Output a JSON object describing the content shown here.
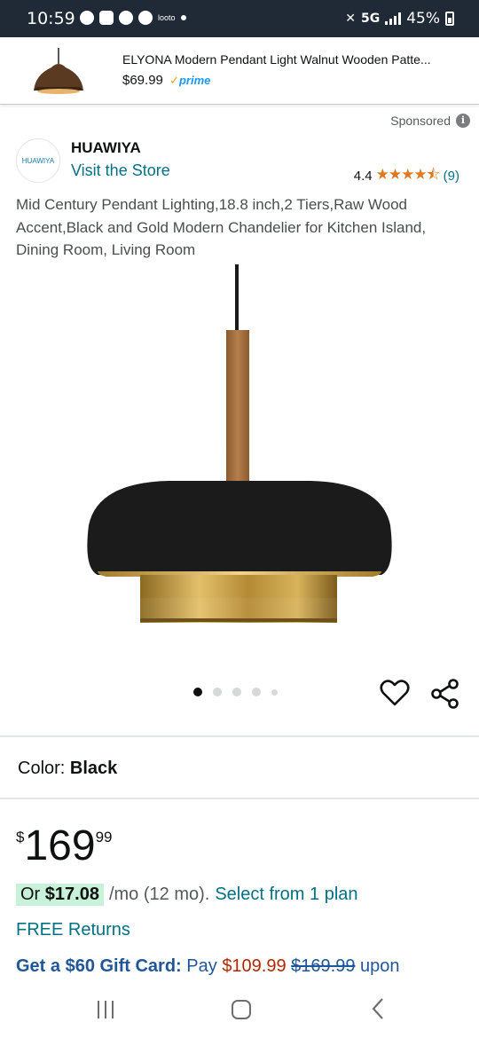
{
  "status_bar": {
    "time": "10:59",
    "tag": "looto",
    "network": "5G",
    "battery": "45%"
  },
  "sticky": {
    "title": "ELYONA Modern Pendant Light Walnut Wooden Patte...",
    "price": "$69.99",
    "prime_label": "prime"
  },
  "sponsored_label": "Sponsored",
  "brand": {
    "logo_text": "HUAWIYA",
    "name": "HUAWIYA",
    "visit_store": "Visit the Store"
  },
  "rating": {
    "value": "4.4",
    "count": "(9)",
    "stars": "★★★★⯪"
  },
  "product": {
    "title": "Mid Century Pendant Lighting,18.8 inch,2 Tiers,Raw Wood Accent,Black and Gold Modern Chandelier for Kitchen Island, Dining Room, Living Room"
  },
  "color": {
    "label": "Color:",
    "value": "Black"
  },
  "price": {
    "symbol": "$",
    "whole": "169",
    "fraction": "99"
  },
  "installment": {
    "or_label": "Or",
    "amount": "$17.08",
    "term": "/mo (12 mo).",
    "link": "Select from 1 plan"
  },
  "free_returns": "FREE Returns",
  "gift_card": {
    "headline": "Get a $60 Gift Card:",
    "pay": "Pay",
    "new_price": "$109.99",
    "old_price": "$169.99",
    "tail": "upon"
  },
  "colors": {
    "link": "#007185",
    "price_red": "#b12704",
    "star": "#de7921",
    "status_bar": "#1f2a36"
  }
}
